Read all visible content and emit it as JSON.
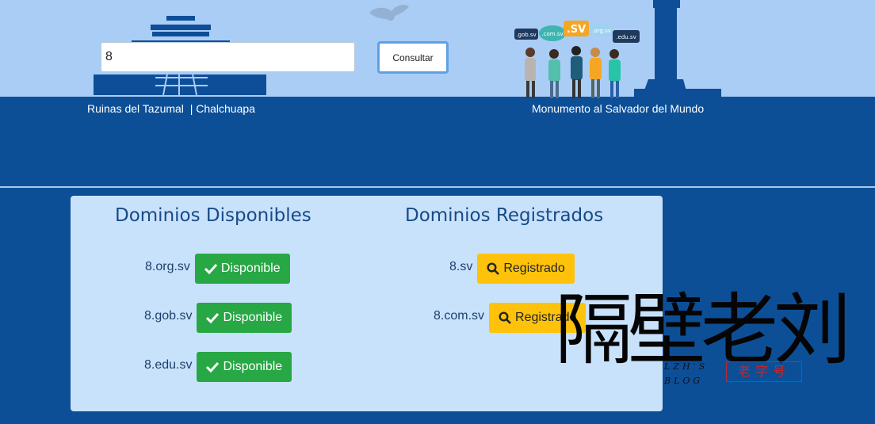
{
  "search": {
    "value": "8",
    "button_label": "Consultar"
  },
  "captions": {
    "left": "Ruinas del Tazumal  | Chalchuapa",
    "right": "Monumento al Salvador del Mundo"
  },
  "signs": [
    ".gob.sv",
    ".com.sv",
    ".SV",
    ".org.sv",
    ".edu.sv"
  ],
  "available": {
    "title": "Dominios Disponibles",
    "items": [
      {
        "domain": "8.org.sv",
        "status": "Disponible"
      },
      {
        "domain": "8.gob.sv",
        "status": "Disponible"
      },
      {
        "domain": "8.edu.sv",
        "status": "Disponible"
      }
    ]
  },
  "registered": {
    "title": "Dominios Registrados",
    "items": [
      {
        "domain": "8.sv",
        "status": "Registrado"
      },
      {
        "domain": "8.com.sv",
        "status": "Registrado"
      }
    ]
  },
  "watermark": {
    "main": "隔壁老刘",
    "sub1": "LZH'S",
    "sub2": "BLOG",
    "seal": "老字号"
  },
  "colors": {
    "sky": "#aacdf6",
    "ground": "#0d4f97",
    "panel": "#c9e2fc",
    "available": "#28a745",
    "registered": "#fec20b"
  },
  "icons": {
    "available": "check-icon",
    "registered": "search-icon"
  }
}
